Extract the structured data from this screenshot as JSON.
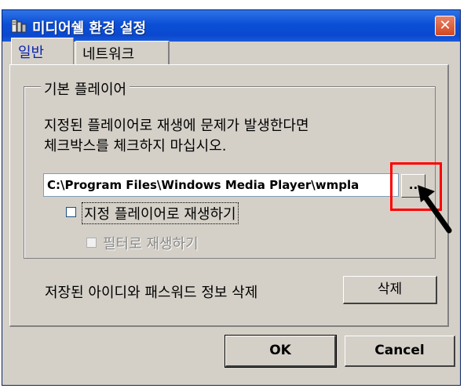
{
  "window": {
    "title": "미디어쉘 환경 설정",
    "close_glyph": "✕"
  },
  "tabs": [
    {
      "label": "일반",
      "active": true
    },
    {
      "label": "네트워크",
      "active": false
    }
  ],
  "default_player": {
    "group_title": "기본 플레이어",
    "description_line1": "지정된 플레이어로 재생에 문제가 발생한다면",
    "description_line2": "체크박스를 체크하지 마십시오.",
    "path_value": "C:\\Program Files\\Windows Media Player\\wmpla",
    "browse_label": "..",
    "use_player_label": "지정 플레이어로 재생하기",
    "use_player_checked": false,
    "filter_label": "필터로 재생하기",
    "filter_checked": false,
    "filter_enabled": false
  },
  "credentials": {
    "label": "저장된 아이디와 패스워드 정보 삭제",
    "delete_label": "삭제"
  },
  "footer": {
    "ok_label": "OK",
    "cancel_label": "Cancel"
  },
  "colors": {
    "titlebar": "#0b4fd6",
    "highlight": "#ff0000",
    "dialog_bg": "#d4d0c8"
  }
}
